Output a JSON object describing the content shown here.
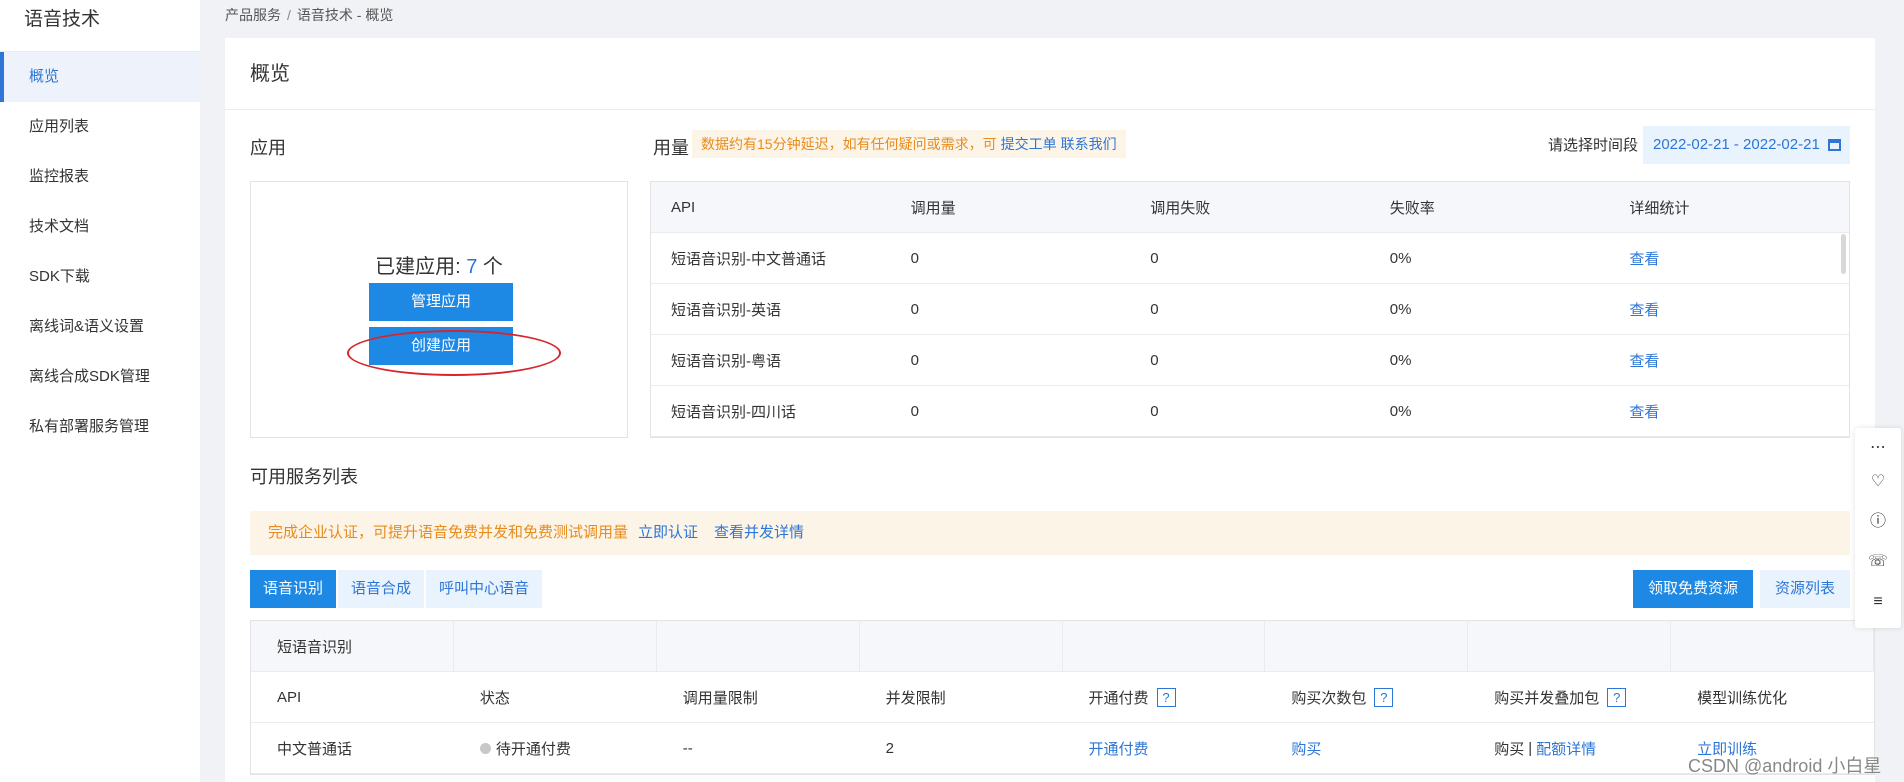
{
  "sidebar": {
    "title": "语音技术",
    "items": [
      {
        "label": "概览",
        "active": true
      },
      {
        "label": "应用列表"
      },
      {
        "label": "监控报表"
      },
      {
        "label": "技术文档"
      },
      {
        "label": "SDK下载"
      },
      {
        "label": "离线词&语义设置"
      },
      {
        "label": "离线合成SDK管理"
      },
      {
        "label": "私有部署服务管理"
      }
    ]
  },
  "breadcrumb": {
    "root": "产品服务",
    "sep": "/",
    "current": "语音技术 - 概览"
  },
  "page": {
    "title": "概览"
  },
  "apps": {
    "title": "应用",
    "count_label": "已建应用: ",
    "count": "7",
    "count_unit": " 个",
    "manage_label": "管理应用",
    "create_label": "创建应用"
  },
  "usage": {
    "title": "用量",
    "notice": "数据约有15分钟延迟，如有任何疑问或需求，可",
    "ticket_link": "提交工单",
    "contact_link": "联系我们",
    "time_label": "请选择时间段",
    "date_range": "2022-02-21 - 2022-02-21",
    "columns": [
      "API",
      "调用量",
      "调用失败",
      "失败率",
      "详细统计"
    ],
    "rows": [
      {
        "api": "短语音识别-中文普通话",
        "calls": "0",
        "fails": "0",
        "rate": "0%",
        "detail": "查看"
      },
      {
        "api": "短语音识别-英语",
        "calls": "0",
        "fails": "0",
        "rate": "0%",
        "detail": "查看"
      },
      {
        "api": "短语音识别-粤语",
        "calls": "0",
        "fails": "0",
        "rate": "0%",
        "detail": "查看"
      },
      {
        "api": "短语音识别-四川话",
        "calls": "0",
        "fails": "0",
        "rate": "0%",
        "detail": "查看"
      }
    ]
  },
  "services": {
    "title": "可用服务列表",
    "notice": "完成企业认证，可提升语音免费并发和免费测试调用量",
    "verify_link": "立即认证",
    "concurrency_link": "查看并发详情",
    "tabs": [
      "语音识别",
      "语音合成",
      "呼叫中心语音"
    ],
    "free_button": "领取免费资源",
    "resource_button": "资源列表",
    "group": "短语音识别",
    "columns": [
      "API",
      "状态",
      "调用量限制",
      "并发限制",
      "开通付费",
      "购买次数包",
      "购买并发叠加包",
      "模型训练优化"
    ],
    "help_mark": "?",
    "row": {
      "api": "中文普通话",
      "status": "待开通付费",
      "call_limit": "--",
      "concurrency": "2",
      "pay": "开通付费",
      "buy": "购买",
      "buy2": "购买",
      "buy2_sep": "|",
      "quota_detail": "配额详情",
      "train": "立即训练"
    }
  },
  "watermark": "CSDN @android 小白星"
}
